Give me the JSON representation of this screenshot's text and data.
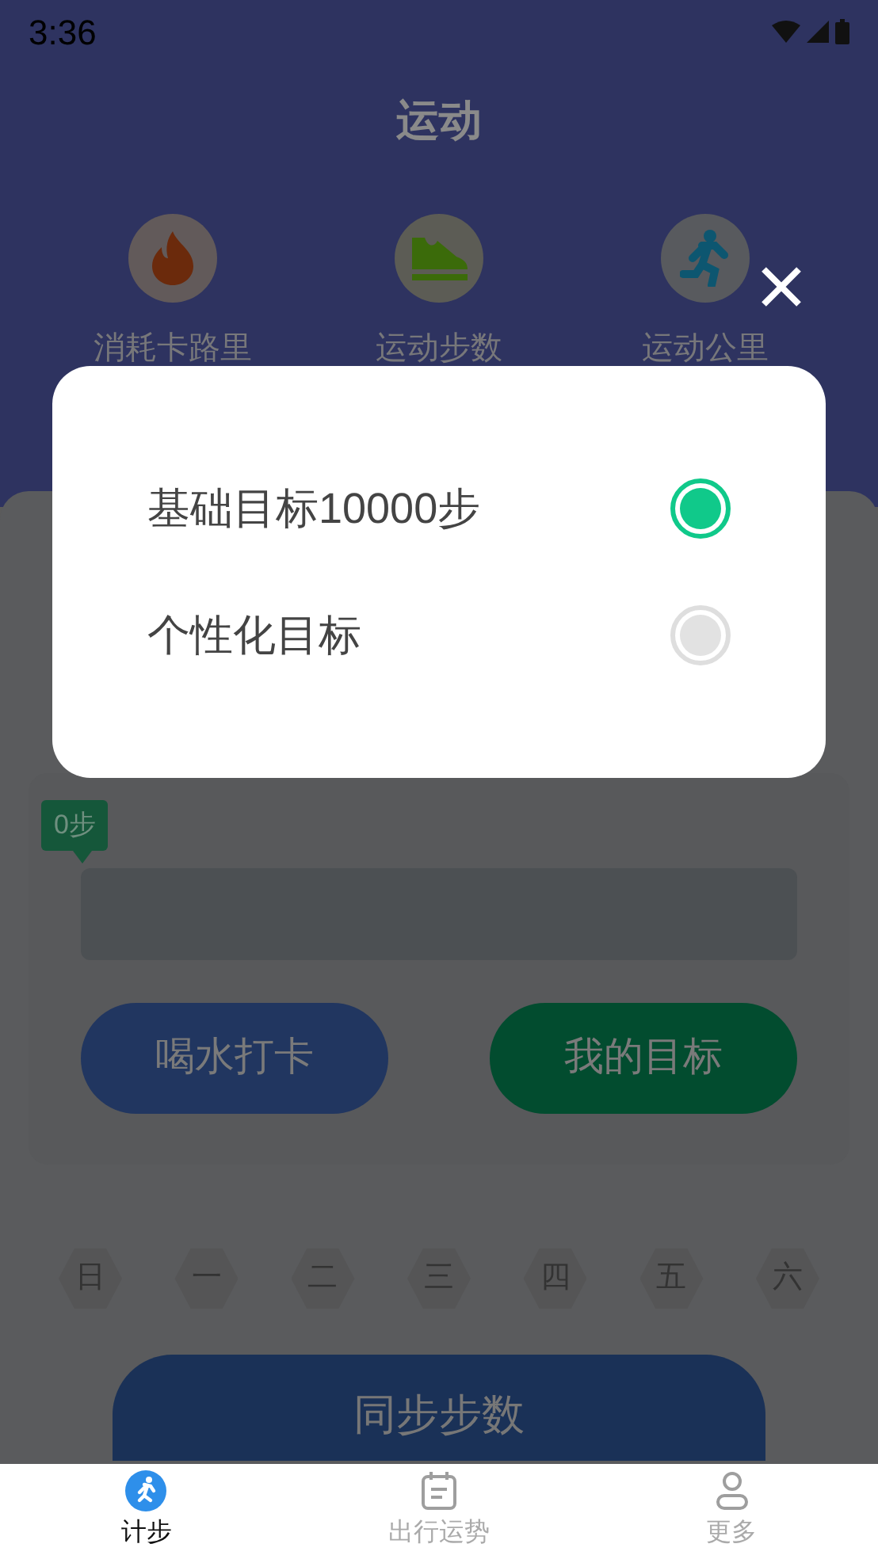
{
  "status_bar": {
    "time": "3:36"
  },
  "header": {
    "title": "运动"
  },
  "stats": [
    {
      "kind": "flame",
      "label": "消耗卡路里"
    },
    {
      "kind": "shoe",
      "label": "运动步数"
    },
    {
      "kind": "runner",
      "label": "运动公里"
    }
  ],
  "dialog": {
    "options": [
      {
        "label": "基础目标10000步",
        "selected": true
      },
      {
        "label": "个性化目标",
        "selected": false
      }
    ]
  },
  "progress": {
    "tooltip": "0步"
  },
  "buttons": [
    {
      "kind": "water",
      "label": "喝水打卡"
    },
    {
      "kind": "goal",
      "label": "我的目标"
    }
  ],
  "weekdays": [
    "日",
    "一",
    "二",
    "三",
    "四",
    "五",
    "六"
  ],
  "sync_button": "同步步数",
  "bottom_nav": [
    {
      "label": "计步",
      "selected": true
    },
    {
      "label": "出行运势",
      "selected": false
    },
    {
      "label": "更多",
      "selected": false
    }
  ]
}
